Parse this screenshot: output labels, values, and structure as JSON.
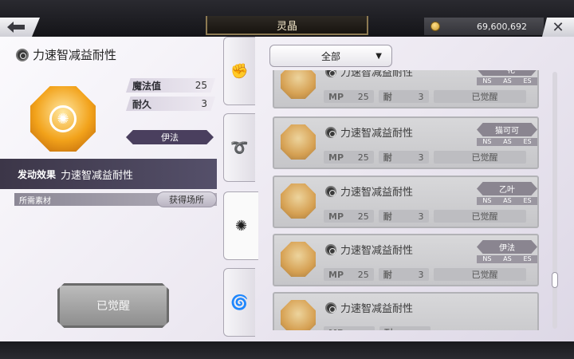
{
  "header": {
    "title": "灵晶",
    "currency_amount": "69,600,692",
    "back_icon": "back-arrow-icon",
    "close_icon": "close-x-icon"
  },
  "detail": {
    "name": "力速智减益耐性",
    "stats": [
      {
        "label": "魔法值",
        "value": "25"
      },
      {
        "label": "耐久",
        "value": "3"
      }
    ],
    "owner": "伊法",
    "effect_label": "发动效果",
    "effect_value": "力速智减益耐性",
    "materials_label": "所需素材",
    "obtain_label": "获得场所",
    "awaken_label": "已觉醒"
  },
  "tabs": [
    {
      "icon": "fist-icon",
      "glyph": "✊"
    },
    {
      "icon": "swirl-arrow-icon",
      "glyph": "➰"
    },
    {
      "icon": "spark-wheel-icon",
      "glyph": "✺"
    },
    {
      "icon": "wave-spiral-icon",
      "glyph": "🌀"
    }
  ],
  "filter": {
    "selected": "全部"
  },
  "list": {
    "items": [
      {
        "name": "力速智减益耐性",
        "owner": "一花",
        "flags": [
          "NS",
          "AS",
          "ES"
        ],
        "mp_label": "MP",
        "mp": "25",
        "dur_label": "耐",
        "dur": "3",
        "status": "已觉醒"
      },
      {
        "name": "力速智减益耐性",
        "owner": "猫可可",
        "flags": [
          "NS",
          "AS",
          "ES"
        ],
        "mp_label": "MP",
        "mp": "25",
        "dur_label": "耐",
        "dur": "3",
        "status": "已觉醒"
      },
      {
        "name": "力速智减益耐性",
        "owner": "乙叶",
        "flags": [
          "NS",
          "AS",
          "ES"
        ],
        "mp_label": "MP",
        "mp": "25",
        "dur_label": "耐",
        "dur": "3",
        "status": "已觉醒"
      },
      {
        "name": "力速智减益耐性",
        "owner": "伊法",
        "flags": [
          "NS",
          "AS",
          "ES"
        ],
        "mp_label": "MP",
        "mp": "25",
        "dur_label": "耐",
        "dur": "3",
        "status": "已觉醒"
      },
      {
        "name": "力速智减益耐性",
        "owner": "",
        "flags": [],
        "mp_label": "MP",
        "mp": "",
        "dur_label": "耐",
        "dur": "",
        "status": ""
      }
    ]
  }
}
